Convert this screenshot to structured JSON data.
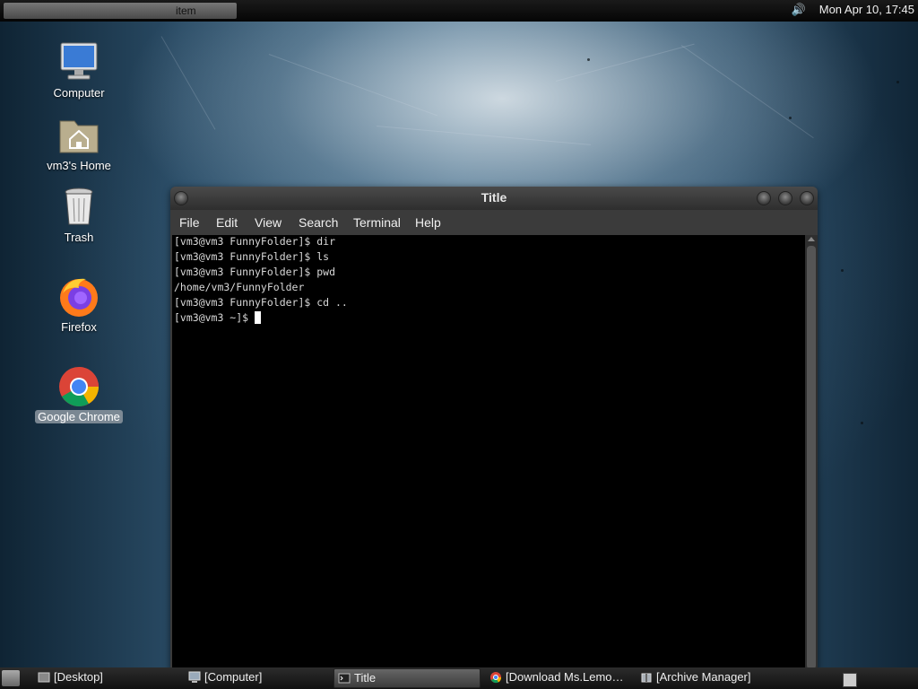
{
  "top_panel": {
    "menu_fragment": "item",
    "volume_icon": "volume-icon",
    "clock": "Mon Apr 10, 17:45"
  },
  "desktop_icons": [
    {
      "label": "Computer",
      "icon": "computer-icon"
    },
    {
      "label": "vm3's Home",
      "icon": "home-folder-icon"
    },
    {
      "label": "Trash",
      "icon": "trash-icon"
    },
    {
      "label": "Firefox",
      "icon": "firefox-icon"
    },
    {
      "label": "Google Chrome",
      "icon": "chrome-icon",
      "selected": true
    }
  ],
  "terminal": {
    "title": "Title",
    "menu": [
      "File",
      "Edit",
      "View",
      "Search",
      "Terminal",
      "Help"
    ],
    "lines": [
      "[vm3@vm3 FunnyFolder]$ dir",
      "[vm3@vm3 FunnyFolder]$ ls",
      "[vm3@vm3 FunnyFolder]$ pwd",
      "/home/vm3/FunnyFolder",
      "[vm3@vm3 FunnyFolder]$ cd ..",
      "[vm3@vm3 ~]$ "
    ]
  },
  "taskbar": {
    "tasks": [
      {
        "label": "[Desktop]",
        "icon": "desktop-icon",
        "active": false
      },
      {
        "label": "[Computer]",
        "icon": "computer-icon",
        "active": false
      },
      {
        "label": "Title",
        "icon": "terminal-icon",
        "active": true
      },
      {
        "label": "[Download Ms.Lemo…",
        "icon": "chrome-icon",
        "active": false
      },
      {
        "label": "[Archive Manager]",
        "icon": "archive-icon",
        "active": false
      }
    ]
  },
  "colors": {
    "terminal_bg": "#000000",
    "terminal_fg": "#d8d8d8",
    "panel_bg": "#111111"
  }
}
